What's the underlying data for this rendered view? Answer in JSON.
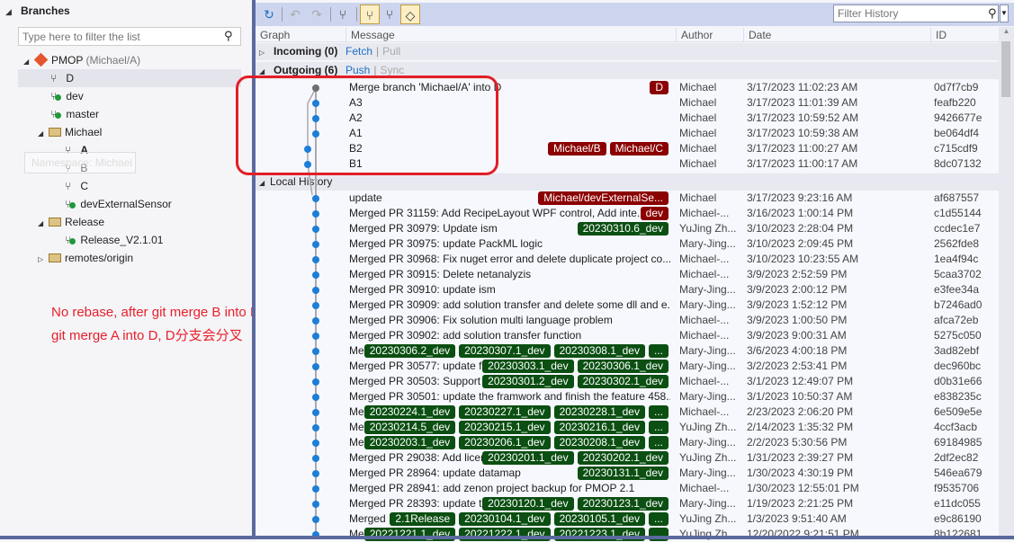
{
  "branches_panel": {
    "title": "Branches",
    "filter_placeholder": "Type here to filter the list",
    "repo": "PMOP",
    "repo_branch": "(Michael/A)",
    "items": [
      {
        "label": "D",
        "kind": "local",
        "depth": 2,
        "selected": true
      },
      {
        "label": "dev",
        "kind": "tracked",
        "depth": 2
      },
      {
        "label": "master",
        "kind": "tracked",
        "depth": 2
      },
      {
        "label": "Michael",
        "kind": "folder",
        "depth": 2
      },
      {
        "label": "A",
        "kind": "local",
        "depth": 3,
        "bold": true
      },
      {
        "label": "B",
        "kind": "local",
        "depth": 3
      },
      {
        "label": "C",
        "kind": "local",
        "depth": 3
      },
      {
        "label": "devExternalSensor",
        "kind": "tracked",
        "depth": 3
      },
      {
        "label": "Release",
        "kind": "folder",
        "depth": 2
      },
      {
        "label": "Release_V2.1.01",
        "kind": "tracked",
        "depth": 3
      },
      {
        "label": "remotes/origin",
        "kind": "remote-folder",
        "depth": 2,
        "collapsed": true
      }
    ],
    "tooltip": "Namespace: Michael"
  },
  "annotation": "No rebase, after git merge B into D and git merge A into D, D分支会分叉",
  "toolbar": {
    "filter_placeholder": "Filter History",
    "icons": [
      "refresh-icon",
      "go-back-icon",
      "go-forward-icon",
      "graph-icon",
      "show-local-branches-icon",
      "show-remote-branches-icon",
      "show-tags-icon"
    ]
  },
  "columns": [
    "Graph",
    "Message",
    "Author",
    "Date",
    "ID"
  ],
  "incoming": {
    "label": "Incoming (0)",
    "fetch": "Fetch",
    "pull": "Pull"
  },
  "outgoing": {
    "label": "Outgoing (6)",
    "push": "Push",
    "sync": "Sync"
  },
  "local_history_label": "Local History",
  "colors": {
    "red_tag": "#8b0000",
    "green_tag": "#0b4f12",
    "annotation": "#e8202a",
    "graph_dot": "#1d7ed8"
  },
  "outgoing_rows": [
    {
      "msg": "Merge branch 'Michael/A' into D",
      "tags": [
        {
          "t": "D",
          "c": "r"
        }
      ],
      "author": "Michael",
      "date": "3/17/2023 11:02:23 AM",
      "id": "0d7f7cb9"
    },
    {
      "msg": "A3",
      "tags": [],
      "author": "Michael",
      "date": "3/17/2023 11:01:39 AM",
      "id": "feafb220"
    },
    {
      "msg": "A2",
      "tags": [],
      "author": "Michael",
      "date": "3/17/2023 10:59:52 AM",
      "id": "9426677e"
    },
    {
      "msg": "A1",
      "tags": [],
      "author": "Michael",
      "date": "3/17/2023 10:59:38 AM",
      "id": "be064df4"
    },
    {
      "msg": "B2",
      "tags": [
        {
          "t": "Michael/B",
          "c": "r"
        },
        {
          "t": "Michael/C",
          "c": "r"
        }
      ],
      "author": "Michael",
      "date": "3/17/2023 11:00:27 AM",
      "id": "c715cdf9"
    },
    {
      "msg": "B1",
      "tags": [],
      "author": "Michael",
      "date": "3/17/2023 11:00:17 AM",
      "id": "8dc07132"
    }
  ],
  "local_rows": [
    {
      "msg": "update",
      "tags": [
        {
          "t": "Michael/devExternalSe...",
          "c": "r"
        }
      ],
      "author": "Michael",
      "date": "3/17/2023 9:23:16 AM",
      "id": "af687557"
    },
    {
      "msg": "Merged PR 31159: Add RecipeLayout WPF control, Add inte...",
      "tags": [
        {
          "t": "dev",
          "c": "r"
        }
      ],
      "author": "Michael-...",
      "date": "3/16/2023 1:00:14 PM",
      "id": "c1d55144"
    },
    {
      "msg": "Merged PR 30979: Update ism",
      "tags": [
        {
          "t": "20230310.6_dev",
          "c": "g"
        }
      ],
      "author": "YuJing Zh...",
      "date": "3/10/2023 2:28:04 PM",
      "id": "ccdec1e7"
    },
    {
      "msg": "Merged PR 30975: update PackML logic",
      "tags": [],
      "author": "Mary-Jing...",
      "date": "3/10/2023 2:09:45 PM",
      "id": "2562fde8"
    },
    {
      "msg": "Merged PR 30968: Fix nuget error and delete duplicate project co...",
      "tags": [],
      "author": "Michael-...",
      "date": "3/10/2023 10:23:55 AM",
      "id": "1ea4f94c"
    },
    {
      "msg": "Merged PR 30915: Delete netanalyzis",
      "tags": [],
      "author": "Michael-...",
      "date": "3/9/2023 2:52:59 PM",
      "id": "5caa3702"
    },
    {
      "msg": "Merged PR 30910: update ism",
      "tags": [],
      "author": "Mary-Jing...",
      "date": "3/9/2023 2:00:12 PM",
      "id": "e3fee34a"
    },
    {
      "msg": "Merged PR 30909: add solution transfer and delete some dll and e...",
      "tags": [],
      "author": "Mary-Jing...",
      "date": "3/9/2023 1:52:12 PM",
      "id": "b7246ad0"
    },
    {
      "msg": "Merged PR 30906: Fix solution multi language problem",
      "tags": [],
      "author": "Michael-...",
      "date": "3/9/2023 1:00:50 PM",
      "id": "afca72eb"
    },
    {
      "msg": "Merged PR 30902: add solution transfer function",
      "tags": [],
      "author": "Michael-...",
      "date": "3/9/2023 9:00:31 AM",
      "id": "5275c050"
    },
    {
      "msg": "Merge...",
      "tags": [
        {
          "t": "20230306.2_dev",
          "c": "g"
        },
        {
          "t": "20230307.1_dev",
          "c": "g"
        },
        {
          "t": "20230308.1_dev",
          "c": "g"
        },
        {
          "t": "...",
          "c": "g"
        }
      ],
      "author": "Mary-Jing...",
      "date": "3/6/2023 4:00:18 PM",
      "id": "3ad82ebf"
    },
    {
      "msg": "Merged PR 30577: update fra...",
      "tags": [
        {
          "t": "20230303.1_dev",
          "c": "g"
        },
        {
          "t": "20230306.1_dev",
          "c": "g"
        }
      ],
      "author": "Mary-Jing...",
      "date": "3/2/2023 2:53:41 PM",
      "id": "dec960bc"
    },
    {
      "msg": "Merged PR 30503: Support so...",
      "tags": [
        {
          "t": "20230301.2_dev",
          "c": "g"
        },
        {
          "t": "20230302.1_dev",
          "c": "g"
        }
      ],
      "author": "Michael-...",
      "date": "3/1/2023 12:49:07 PM",
      "id": "d0b31e66"
    },
    {
      "msg": "Merged PR 30501: update the framwork and finish the feature 458...",
      "tags": [],
      "author": "Mary-Jing...",
      "date": "3/1/2023 10:50:37 AM",
      "id": "e838235c"
    },
    {
      "msg": "Merge...",
      "tags": [
        {
          "t": "20230224.1_dev",
          "c": "g"
        },
        {
          "t": "20230227.1_dev",
          "c": "g"
        },
        {
          "t": "20230228.1_dev",
          "c": "g"
        },
        {
          "t": "...",
          "c": "g"
        }
      ],
      "author": "Michael-...",
      "date": "2/23/2023 2:06:20 PM",
      "id": "6e509e5e"
    },
    {
      "msg": "Merge...",
      "tags": [
        {
          "t": "20230214.5_dev",
          "c": "g"
        },
        {
          "t": "20230215.1_dev",
          "c": "g"
        },
        {
          "t": "20230216.1_dev",
          "c": "g"
        },
        {
          "t": "...",
          "c": "g"
        }
      ],
      "author": "YuJing Zh...",
      "date": "2/14/2023 1:35:32 PM",
      "id": "4ccf3acb"
    },
    {
      "msg": "Merge...",
      "tags": [
        {
          "t": "20230203.1_dev",
          "c": "g"
        },
        {
          "t": "20230206.1_dev",
          "c": "g"
        },
        {
          "t": "20230208.1_dev",
          "c": "g"
        },
        {
          "t": "...",
          "c": "g"
        }
      ],
      "author": "Mary-Jing...",
      "date": "2/2/2023 5:30:56 PM",
      "id": "69184985"
    },
    {
      "msg": "Merged PR 29038: Add licenses",
      "tags": [
        {
          "t": "20230201.1_dev",
          "c": "g"
        },
        {
          "t": "20230202.1_dev",
          "c": "g"
        }
      ],
      "author": "YuJing Zh...",
      "date": "1/31/2023 2:39:27 PM",
      "id": "2df2ec82"
    },
    {
      "msg": "Merged PR 28964: update datamap",
      "tags": [
        {
          "t": "20230131.1_dev",
          "c": "g"
        }
      ],
      "author": "Mary-Jing...",
      "date": "1/30/2023 4:30:19 PM",
      "id": "546ea679"
    },
    {
      "msg": "Merged PR 28941: add zenon project backup for PMOP 2.1",
      "tags": [],
      "author": "Michael-...",
      "date": "1/30/2023 12:55:01 PM",
      "id": "f9535706"
    },
    {
      "msg": "Merged PR 28393: update the...",
      "tags": [
        {
          "t": "20230120.1_dev",
          "c": "g"
        },
        {
          "t": "20230123.1_dev",
          "c": "g"
        }
      ],
      "author": "Mary-Jing...",
      "date": "1/19/2023 2:21:25 PM",
      "id": "e11dc055"
    },
    {
      "msg": "Merged PR...",
      "tags": [
        {
          "t": "2.1Release",
          "c": "g"
        },
        {
          "t": "20230104.1_dev",
          "c": "g"
        },
        {
          "t": "20230105.1_dev",
          "c": "g"
        },
        {
          "t": "...",
          "c": "g"
        }
      ],
      "author": "YuJing Zh...",
      "date": "1/3/2023 9:51:40 AM",
      "id": "e9c86190"
    },
    {
      "msg": "Merge...",
      "tags": [
        {
          "t": "20221221.1_dev",
          "c": "g"
        },
        {
          "t": "20221222.1_dev",
          "c": "g"
        },
        {
          "t": "20221223.1_dev",
          "c": "g"
        },
        {
          "t": "...",
          "c": "g"
        }
      ],
      "author": "YuJing Zh...",
      "date": "12/20/2022 9:21:51 PM",
      "id": "8b122681"
    }
  ]
}
